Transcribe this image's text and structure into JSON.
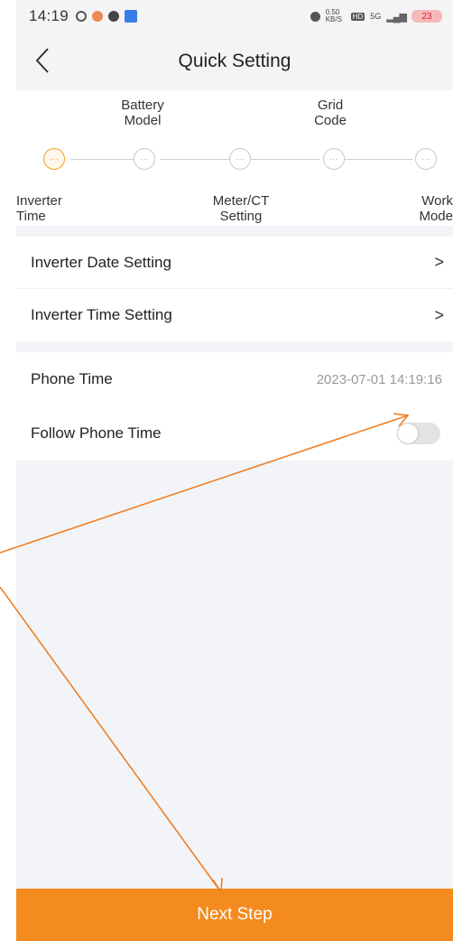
{
  "status_bar": {
    "time": "14:19",
    "net_speed": "0.50 KB/S",
    "hd_label": "HD",
    "signal_label": "5G",
    "battery_text": "23"
  },
  "header": {
    "title": "Quick Setting"
  },
  "stepper": {
    "top_labels": [
      {
        "line1": "Battery",
        "line2": "Model"
      },
      {
        "line1": "Grid",
        "line2": "Code"
      }
    ],
    "bottom_labels": [
      {
        "line1": "Inverter",
        "line2": "Time"
      },
      {
        "line1": "Meter/CT",
        "line2": "Setting"
      },
      {
        "line1": "Work",
        "line2": "Mode"
      }
    ],
    "active_step": 0,
    "node_glyph": "···"
  },
  "settings": {
    "date_setting": "Inverter Date Setting",
    "time_setting": "Inverter Time Setting",
    "chevron": ">",
    "phone_time_label": "Phone Time",
    "phone_time_value": "2023-07-01 14:19:16",
    "follow_label": "Follow Phone Time",
    "follow_enabled": false
  },
  "footer": {
    "next_label": "Next Step"
  },
  "colors": {
    "accent": "#f38b1e",
    "annotation": "#f07a1a"
  }
}
